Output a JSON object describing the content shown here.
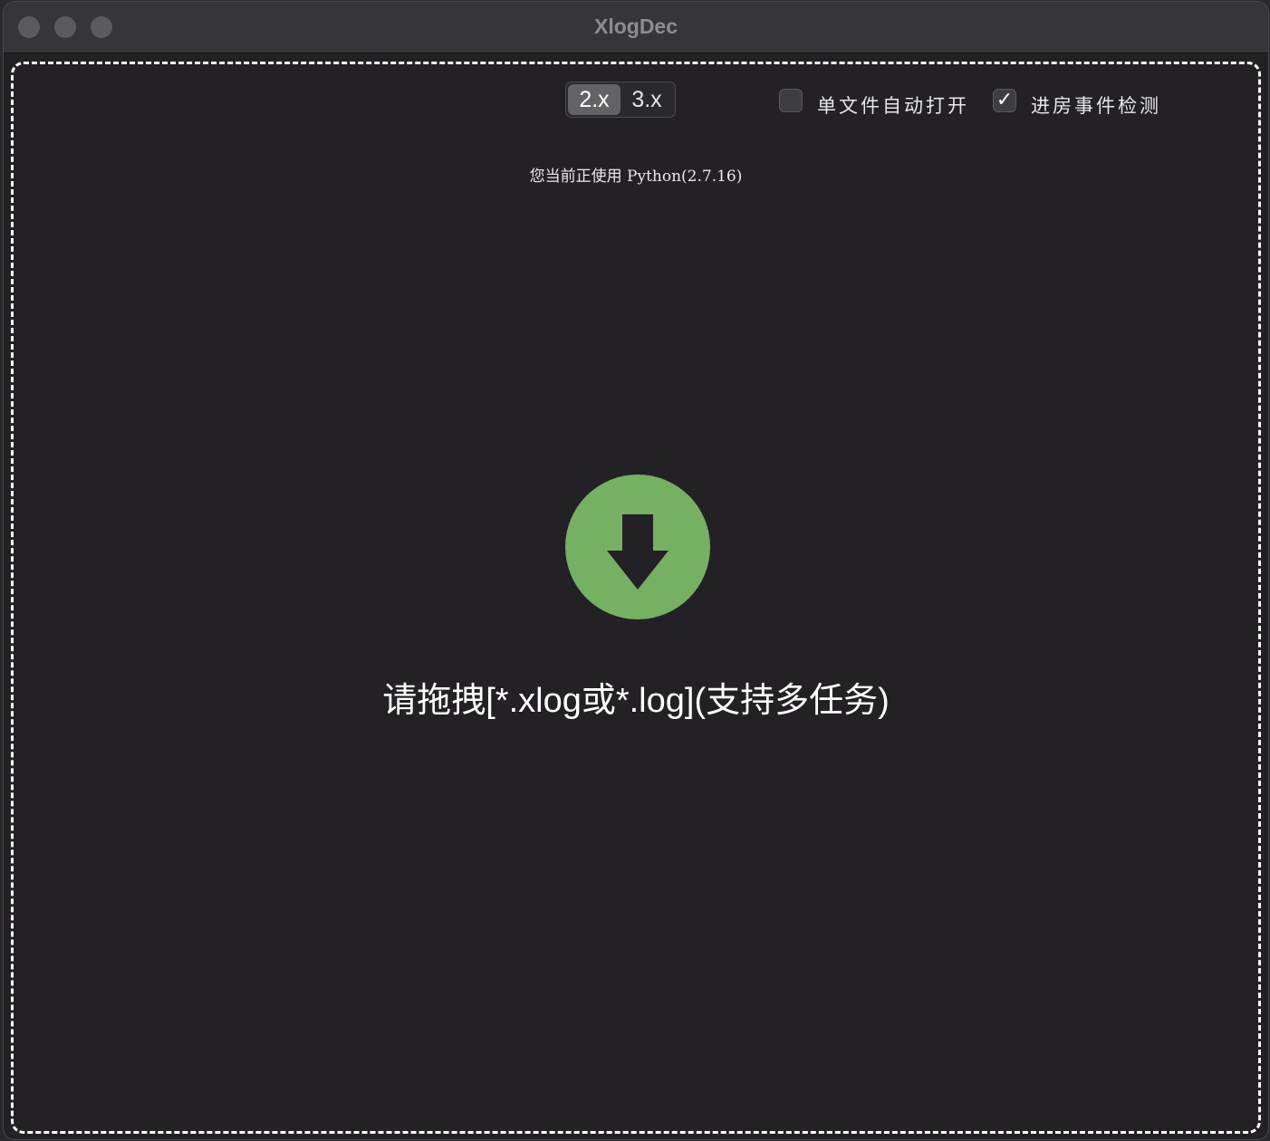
{
  "window": {
    "title": "XlogDec"
  },
  "toolbar": {
    "version_segments": [
      {
        "label": "2.x",
        "selected": true
      },
      {
        "label": "3.x",
        "selected": false
      }
    ],
    "checkboxes": [
      {
        "label": "单文件自动打开",
        "checked": false
      },
      {
        "label": "进房事件检测",
        "checked": true
      }
    ]
  },
  "status": {
    "python_info": "您当前正使用 Python(2.7.16)"
  },
  "drop_zone": {
    "icon": "download-arrow-icon",
    "icon_color": "#76b062",
    "hint": "请拖拽[*.xlog或*.log](支持多任务)"
  },
  "colors": {
    "background": "#232126",
    "titlebar": "#363539",
    "accent_green": "#76b062"
  }
}
